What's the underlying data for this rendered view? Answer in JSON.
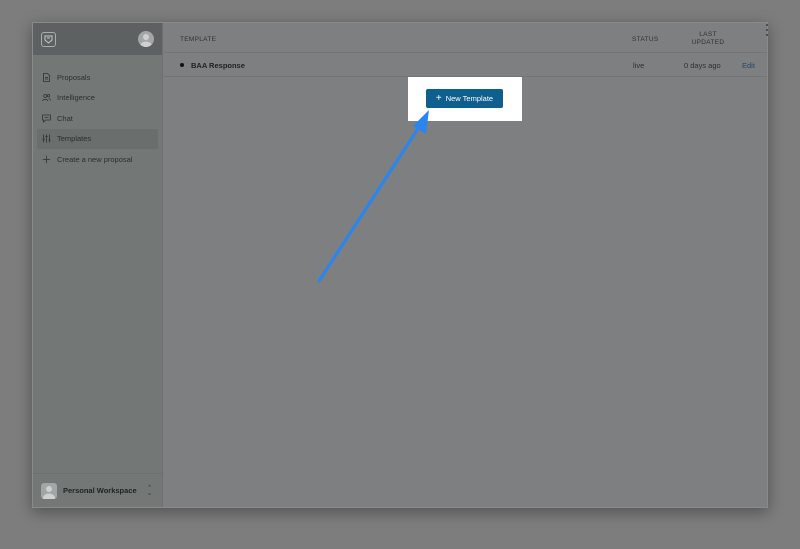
{
  "sidebar": {
    "items": [
      {
        "label": "Proposals",
        "icon": "document-icon",
        "active": false
      },
      {
        "label": "Intelligence",
        "icon": "people-icon",
        "active": false
      },
      {
        "label": "Chat",
        "icon": "chat-icon",
        "active": false
      },
      {
        "label": "Templates",
        "icon": "sliders-icon",
        "active": true
      },
      {
        "label": "Create a new proposal",
        "icon": "plus-icon",
        "active": false
      }
    ],
    "workspace": {
      "label": "Personal Workspace"
    }
  },
  "table": {
    "headers": {
      "template": "TEMPLATE",
      "status": "STATUS",
      "last_updated_line1": "LAST",
      "last_updated_line2": "UPDATED"
    },
    "rows": [
      {
        "name": "BAA Response",
        "status": "live",
        "updated": "0 days ago",
        "action": "Edit"
      }
    ]
  },
  "new_template_button": {
    "label": "New Template",
    "icon": "plus-icon"
  },
  "colors": {
    "button": "#0e5f8e",
    "arrow": "#2a86ee",
    "highlight": "#ffffff"
  }
}
